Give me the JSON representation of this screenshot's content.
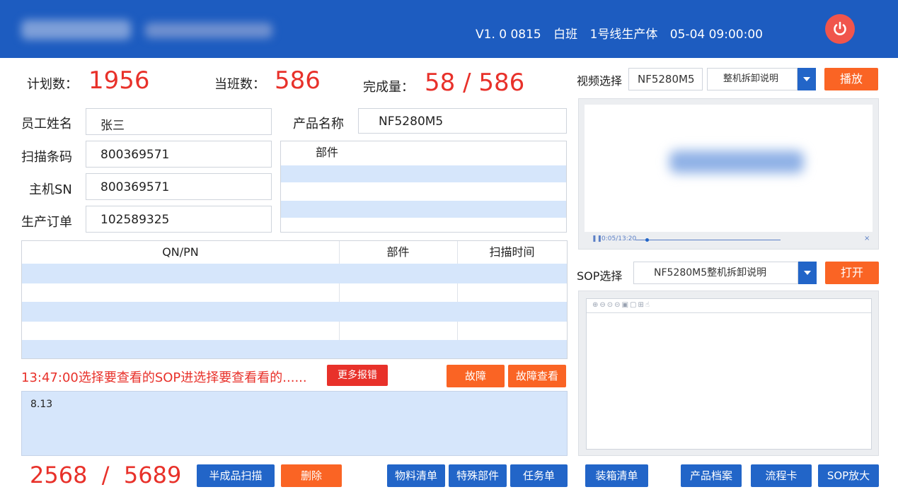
{
  "header": {
    "version": "V1. 0 0815",
    "shift": "白班",
    "line": "1号线生产体",
    "datetime": "05-04 09:00:00"
  },
  "stats": {
    "plan_label": "计划数",
    "plan_value": "1956",
    "shift_label": "当班数",
    "shift_value": "586",
    "done_label": "完成量",
    "done_value": "58 / 586"
  },
  "form": {
    "employee_label": "员工姓名",
    "employee_value": "张三",
    "barcode_label": "扫描条码",
    "barcode_value": "800369571",
    "host_sn_label": "主机SN",
    "host_sn_value": "800369571",
    "order_label": "生产订单",
    "order_value": "102589325",
    "product_label": "产品名称",
    "product_value": "NF5280M5",
    "parts_header": "部件"
  },
  "scan_table": {
    "headers": [
      "QN/PN",
      "部件",
      "扫描时间"
    ]
  },
  "message": {
    "text": "13:47:00选择要查看的SOP进选择要查看看的......",
    "more_errors": "更多报错",
    "fault": "故障",
    "fault_view": "故障查看",
    "note": "8.13"
  },
  "video": {
    "label": "视频选择",
    "model": "NF5280M5",
    "selected": "整机拆卸说明",
    "play": "播放",
    "time": "0:05/13:20"
  },
  "sop": {
    "label": "SOP选择",
    "selected": "NF5280M5整机拆卸说明",
    "open": "打开"
  },
  "footer": {
    "count": "2568  /  5689",
    "semi_scan": "半成品扫描",
    "delete": "删除",
    "bom": "物料清单",
    "special_parts": "特殊部件",
    "task": "任务单",
    "packing": "装箱清单",
    "archive": "产品档案",
    "flow_card": "流程卡",
    "sop_zoom": "SOP放大"
  },
  "colors": {
    "header_bg": "#1d5cc0",
    "accent_red": "#e8312a",
    "orange": "#fa6424",
    "button_blue": "#2265c8",
    "row_blue": "#d6e6fb"
  }
}
